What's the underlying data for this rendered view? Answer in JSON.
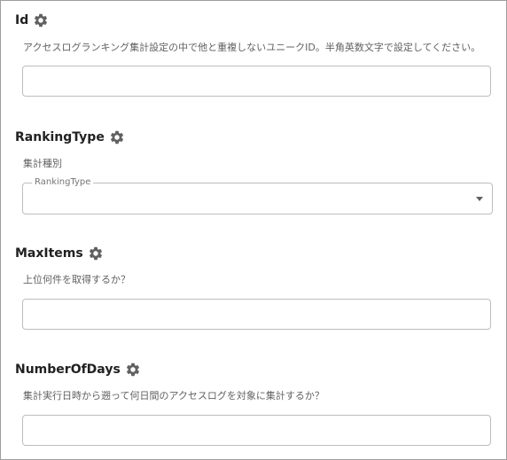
{
  "fields": [
    {
      "title": "Id",
      "description": "アクセスログランキング集計設定の中で他と重複しないユニークID。半角英数文字で設定してください。",
      "value": ""
    },
    {
      "title": "RankingType",
      "description": "集計種別",
      "select_label": "RankingType",
      "selected_value": ""
    },
    {
      "title": "MaxItems",
      "description": "上位何件を取得するか？",
      "value": ""
    },
    {
      "title": "NumberOfDays",
      "description": "集計実行日時から遡って何日間のアクセスログを対象に集計するか？",
      "value": ""
    }
  ],
  "icons": {
    "settings": "gear-icon",
    "dropdown": "chevron-down-icon"
  },
  "colors": {
    "border": "#bdbdbd",
    "title": "#212121",
    "description": "#616161"
  }
}
